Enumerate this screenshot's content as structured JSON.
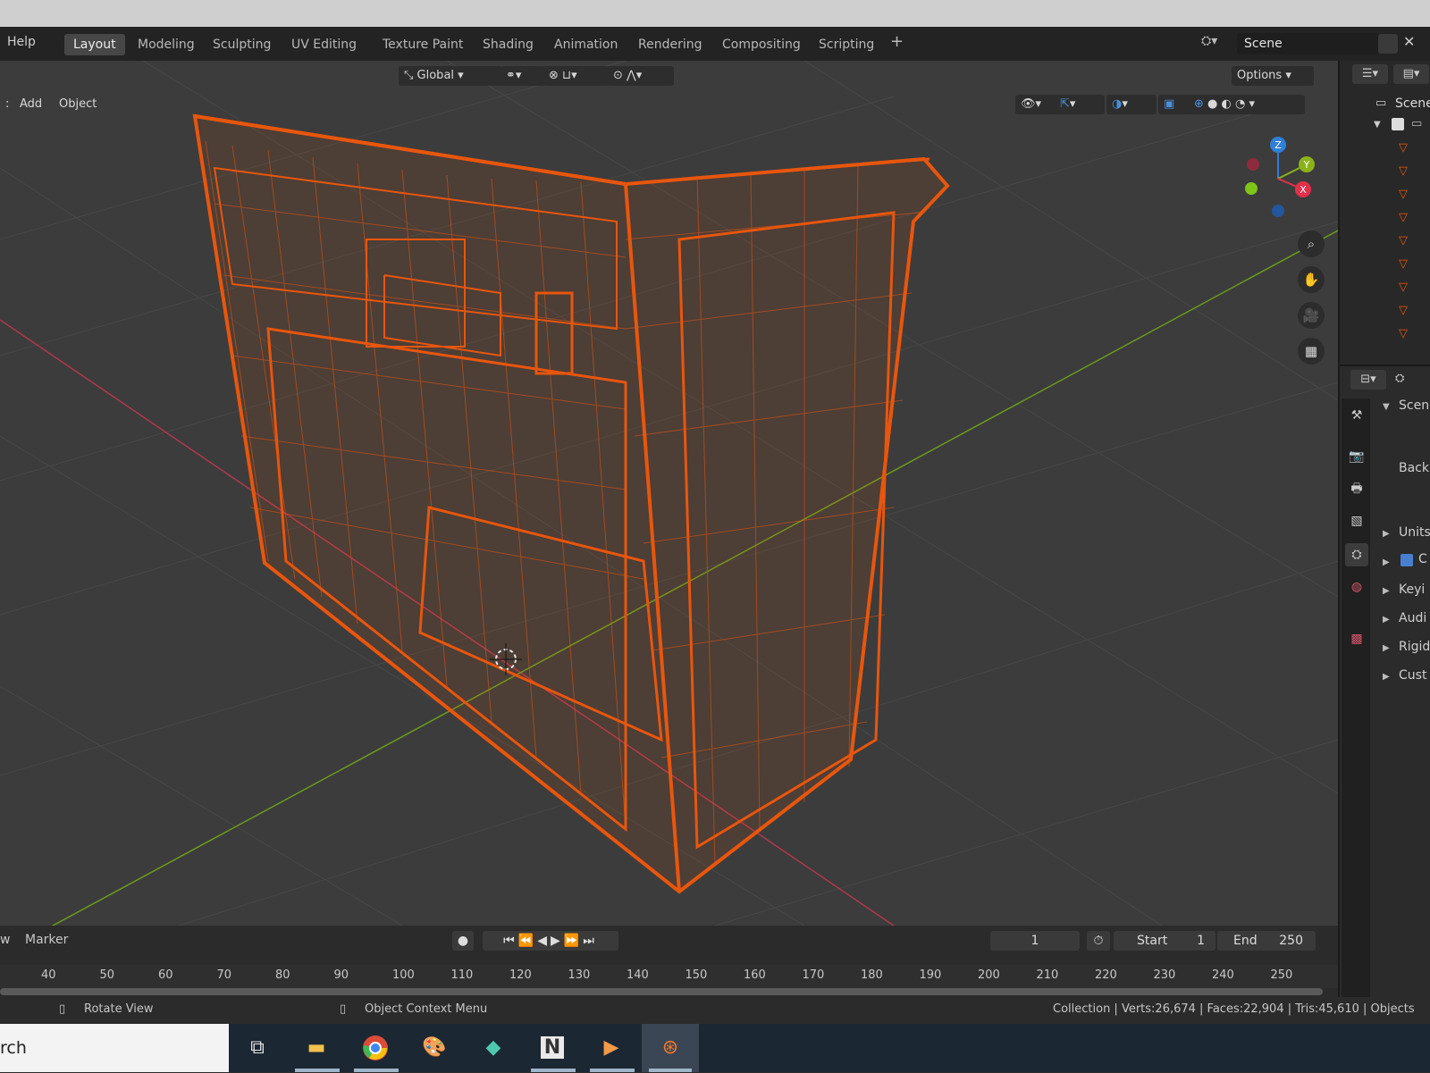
{
  "menubar": {
    "help": "Help",
    "tabs": [
      "Layout",
      "Modeling",
      "Sculpting",
      "UV Editing",
      "Texture Paint",
      "Shading",
      "Animation",
      "Rendering",
      "Compositing",
      "Scripting"
    ],
    "active_tab": "Layout",
    "add_tab": "+",
    "scene_name": "Scene"
  },
  "viewport_header": {
    "menu_partial": ":",
    "add": "Add",
    "object": "Object",
    "orientation": "Global",
    "options": "Options"
  },
  "gizmo": {
    "z": "Z",
    "y": "Y",
    "x": "X"
  },
  "outliner": {
    "scene_label": "Scene"
  },
  "properties": {
    "panel": "Scen",
    "field": "Back",
    "sections": [
      "Units",
      "C",
      "Keyi",
      "Audi",
      "Rigid",
      "Cust"
    ]
  },
  "timeline": {
    "view_partial": "w",
    "marker": "Marker",
    "current_frame": "1",
    "start_label": "Start",
    "start_value": "1",
    "end_label": "End",
    "end_value": "250",
    "ticks": [
      "40",
      "50",
      "60",
      "70",
      "80",
      "90",
      "100",
      "110",
      "120",
      "130",
      "140",
      "150",
      "160",
      "170",
      "180",
      "190",
      "200",
      "210",
      "220",
      "230",
      "240",
      "250"
    ]
  },
  "statusbar": {
    "rotate_view": "Rotate View",
    "context_menu": "Object Context Menu",
    "stats": "Collection | Verts:26,674 | Faces:22,904 | Tris:45,610 | Objects"
  },
  "taskbar": {
    "search_partial": "rch"
  },
  "colors": {
    "wireframe": "#e8560d",
    "x_axis": "#b0384d",
    "y_axis": "#6c9a1e",
    "gizmo_z": "#2f7fd6",
    "gizmo_y": "#8cb21a",
    "gizmo_x": "#e2304a"
  },
  "icons": [
    "view-icon",
    "snap-icon",
    "proportional-icon",
    "overlay-icon",
    "shading-wire-icon",
    "shading-solid-icon",
    "shading-material-icon",
    "shading-render-icon",
    "zoom-icon",
    "hand-icon",
    "camera-icon",
    "grid-icon",
    "record-icon",
    "jump-start-icon",
    "prev-key-icon",
    "play-reverse-icon",
    "play-icon",
    "next-key-icon",
    "jump-end-icon",
    "stopwatch-icon",
    "mouse-icon",
    "task-view-icon",
    "file-explorer-icon",
    "chrome-icon",
    "paint-icon",
    "app-icon",
    "notepad-icon",
    "media-icon",
    "blender-icon"
  ]
}
